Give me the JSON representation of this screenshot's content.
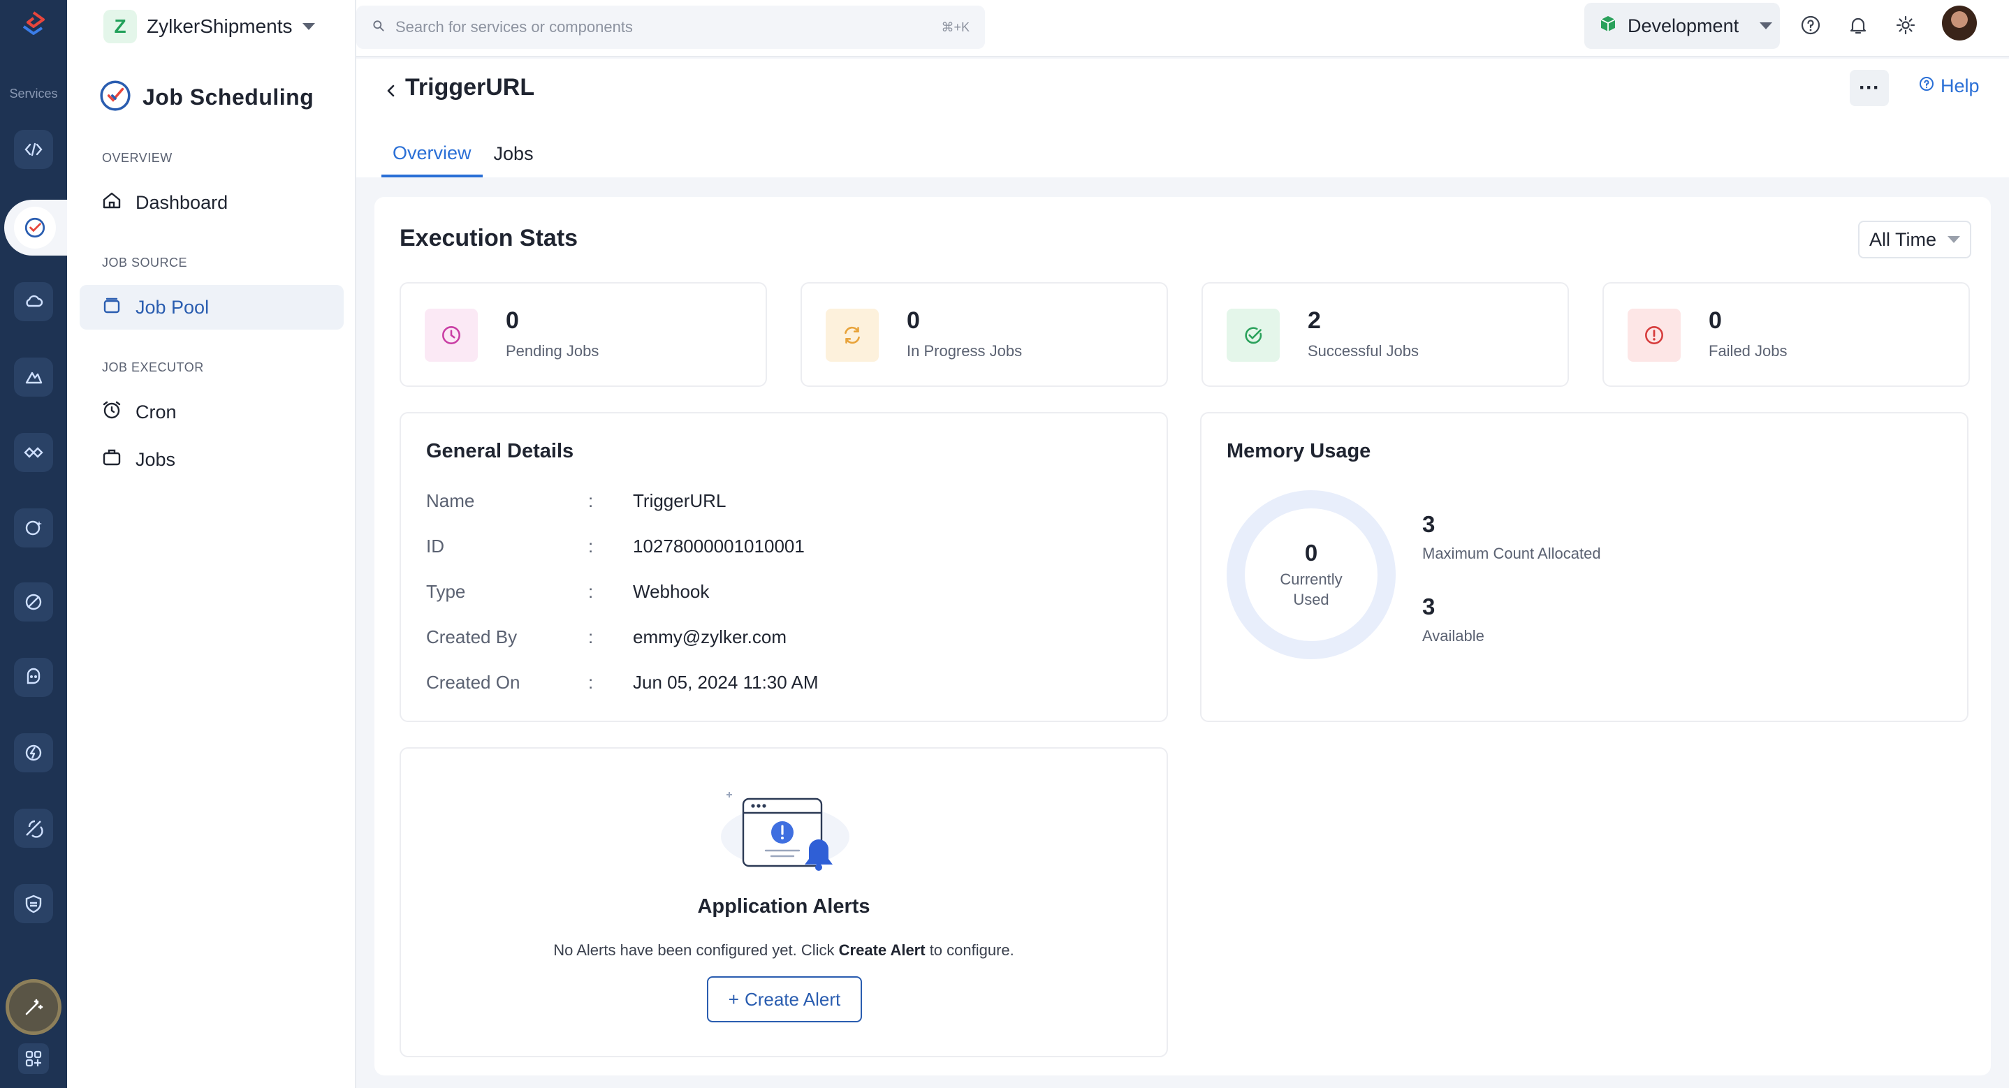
{
  "rail": {
    "caption": "Services"
  },
  "org": {
    "badge": "Z",
    "name": "ZylkerShipments"
  },
  "brand": {
    "title": "Job Scheduling"
  },
  "sidebar": {
    "sections": [
      {
        "label": "OVERVIEW"
      },
      {
        "label": "JOB SOURCE"
      },
      {
        "label": "JOB EXECUTOR"
      }
    ],
    "items": [
      {
        "label": "Dashboard",
        "icon": "home-icon"
      },
      {
        "label": "Job Pool",
        "icon": "stack-icon",
        "active": true
      },
      {
        "label": "Cron",
        "icon": "alarm-clock-icon"
      },
      {
        "label": "Jobs",
        "icon": "briefcase-icon"
      }
    ]
  },
  "search": {
    "placeholder": "Search for services or components",
    "shortcut": "⌘+K"
  },
  "env": {
    "label": "Development"
  },
  "page": {
    "title": "TriggerURL",
    "help_label": "Help",
    "more_label": "···",
    "tabs": [
      {
        "label": "Overview",
        "active": true
      },
      {
        "label": "Jobs",
        "active": false
      }
    ]
  },
  "execution_stats": {
    "title": "Execution Stats",
    "range": "All Time",
    "stats": [
      {
        "value": "0",
        "label": "Pending Jobs",
        "color": "#c93ea4",
        "bg": "#fbe9f5"
      },
      {
        "value": "0",
        "label": "In Progress Jobs",
        "color": "#e8a33a",
        "bg": "#fdf1dc"
      },
      {
        "value": "2",
        "label": "Successful Jobs",
        "color": "#2aa15b",
        "bg": "#e4f6ea"
      },
      {
        "value": "0",
        "label": "Failed Jobs",
        "color": "#d63b3b",
        "bg": "#fde6e6"
      }
    ]
  },
  "general_details": {
    "title": "General Details",
    "separator": ":",
    "rows": [
      {
        "key": "Name",
        "value": "TriggerURL"
      },
      {
        "key": "ID",
        "value": "10278000001010001"
      },
      {
        "key": "Type",
        "value": "Webhook"
      },
      {
        "key": "Created By",
        "value": "emmy@zylker.com"
      },
      {
        "key": "Created On",
        "value": "Jun 05, 2024 11:30 AM"
      }
    ]
  },
  "memory_usage": {
    "title": "Memory Usage",
    "current_value": "0",
    "current_label_line1": "Currently",
    "current_label_line2": "Used",
    "max_value": "3",
    "max_label": "Maximum Count Allocated",
    "available_value": "3",
    "available_label": "Available"
  },
  "alerts": {
    "title": "Application Alerts",
    "text_before": "No Alerts have been configured yet. Click ",
    "text_bold": "Create Alert",
    "text_after": " to configure.",
    "button_label": "Create Alert",
    "button_icon": "+"
  },
  "colors": {
    "accent": "#2a6fd6",
    "rail": "#1e3353"
  }
}
